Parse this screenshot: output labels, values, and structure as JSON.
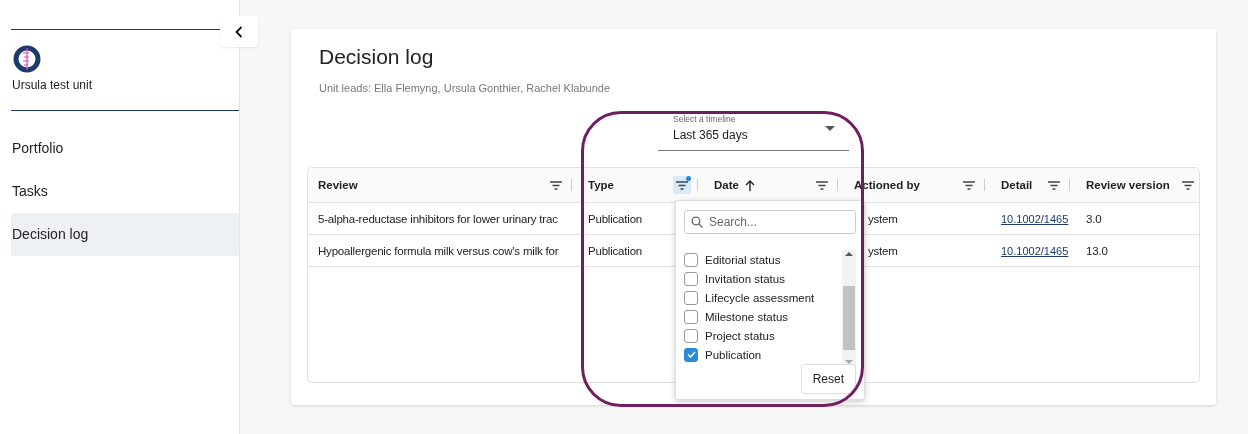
{
  "sidebar": {
    "unit_name": "Ursula test unit",
    "items": [
      {
        "label": "Portfolio",
        "selected": false
      },
      {
        "label": "Tasks",
        "selected": false
      },
      {
        "label": "Decision log",
        "selected": true
      }
    ]
  },
  "page": {
    "title": "Decision log",
    "subtitle": "Unit leads: Ella Flemyng, Ursula Gonthier, Rachel Klabunde"
  },
  "timeline": {
    "label": "Select a timeline",
    "value": "Last 365 days"
  },
  "table": {
    "columns": [
      {
        "label": "Review",
        "filter_active": false
      },
      {
        "label": "Type",
        "filter_active": true
      },
      {
        "label": "Date",
        "filter_active": false,
        "sorted_ascending": true
      },
      {
        "label": "Actioned by",
        "filter_active": false
      },
      {
        "label": "Detail",
        "filter_active": false
      },
      {
        "label": "Review version",
        "filter_active": false
      }
    ],
    "rows": [
      {
        "review": "5-alpha-reductase inhibitors for lower urinary trac",
        "type": "Publication",
        "actioned_by": "ystem",
        "detail": "10.1002/1465",
        "version": "3.0"
      },
      {
        "review": "Hypoallergenic formula milk versus cow's milk for",
        "type": "Publication",
        "actioned_by": "ystem",
        "detail": "10.1002/1465",
        "version": "13.0"
      }
    ]
  },
  "filter_menu": {
    "placeholder": "Search...",
    "options": [
      {
        "label": "Editorial status",
        "checked": false
      },
      {
        "label": "Invitation status",
        "checked": false
      },
      {
        "label": "Lifecycle assessment",
        "checked": false
      },
      {
        "label": "Milestone status",
        "checked": false
      },
      {
        "label": "Project status",
        "checked": false
      },
      {
        "label": "Publication",
        "checked": true
      }
    ],
    "reset": "Reset"
  }
}
